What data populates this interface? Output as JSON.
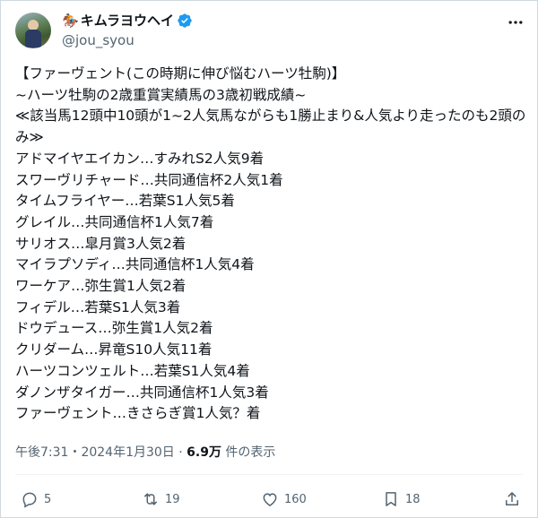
{
  "author": {
    "display_name": "キムラヨウヘイ",
    "emoji": "🏇",
    "handle": "@jou_syou"
  },
  "tweet": {
    "text": "【ファーヴェント(この時期に伸び悩むハーツ牡駒)】\n~ハーツ牡駒の2歳重賞実績馬の3歳初戦成績~\n≪該当馬12頭中10頭が1~2人気馬ながらも1勝止まり&人気より走ったのも2頭のみ≫\nアドマイヤエイカン…すみれS2人気9着\nスワーヴリチャード…共同通信杯2人気1着\nタイムフライヤー…若葉S1人気5着\nグレイル…共同通信杯1人気7着\nサリオス…皐月賞3人気2着\nマイラプソディ…共同通信杯1人気4着\nワーケア…弥生賞1人気2着\nフィデル…若葉S1人気3着\nドウデュース…弥生賞1人気2着\nクリダーム…昇竜S10人気11着\nハーツコンツェルト…若葉S1人気4着\nダノンザタイガー…共同通信杯1人気3着\nファーヴェント…きさらぎ賞1人気？着"
  },
  "meta": {
    "time": "午後7:31",
    "separator": "・",
    "date": "2024年1月30日",
    "views_count": "6.9万",
    "views_label": " 件の表示"
  },
  "actions": {
    "replies": "5",
    "reposts": "19",
    "likes": "160",
    "bookmarks": "18"
  },
  "colors": {
    "verified": "#1d9bf0",
    "secondary_text": "#536471",
    "border": "#cfd9de"
  },
  "icons": [
    "verified-badge-icon",
    "more-icon",
    "reply-icon",
    "repost-icon",
    "like-icon",
    "bookmark-icon",
    "share-icon"
  ]
}
